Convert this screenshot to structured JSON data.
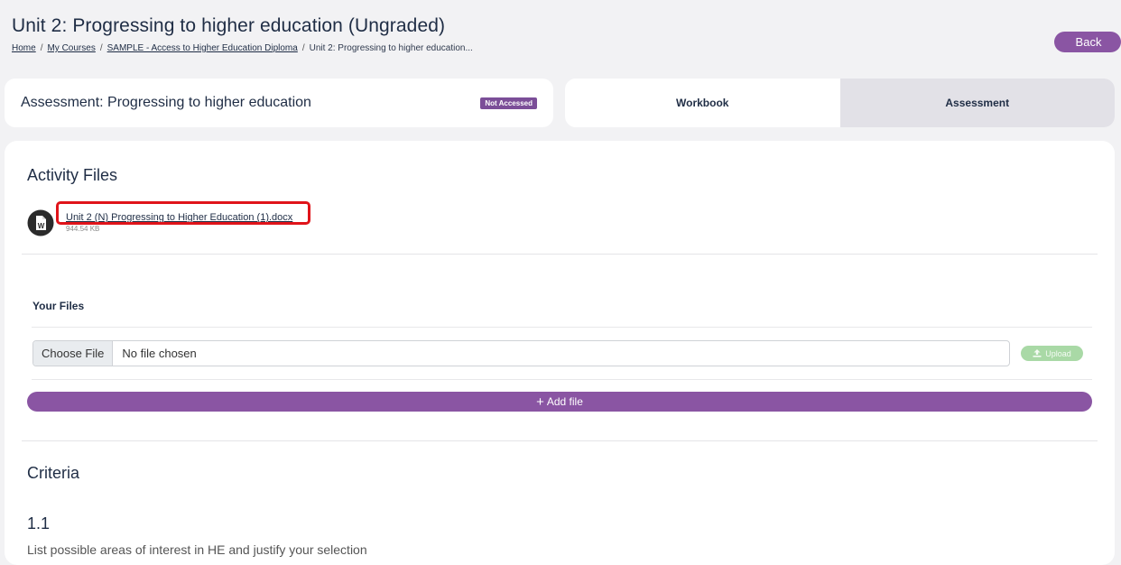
{
  "header": {
    "title": "Unit 2: Progressing to higher education (Ungraded)",
    "back_label": "Back"
  },
  "breadcrumb": {
    "items": [
      {
        "label": "Home"
      },
      {
        "label": "My Courses"
      },
      {
        "label": "SAMPLE - Access to Higher Education Diploma"
      }
    ],
    "current": "Unit 2: Progressing to higher education...",
    "separator": "/"
  },
  "assessment": {
    "title": "Assessment: Progressing to higher education",
    "status": "Not Accessed"
  },
  "tabs": [
    {
      "label": "Workbook",
      "active": false
    },
    {
      "label": "Assessment",
      "active": true
    }
  ],
  "activity_files": {
    "heading": "Activity Files",
    "files": [
      {
        "name": "Unit 2 (N) Progressing to Higher Education (1).docx",
        "size": "944.54 KB",
        "icon": "word-doc-icon"
      }
    ]
  },
  "your_files": {
    "heading": "Your Files",
    "choose_label": "Choose File",
    "no_file_text": "No file chosen",
    "upload_label": "Upload",
    "add_file_label": "Add file"
  },
  "criteria": {
    "heading": "Criteria",
    "number": "1.1",
    "text": "List possible areas of interest in HE and justify your selection"
  },
  "colors": {
    "brand_purple": "#8a55a3",
    "badge_purple": "#7b4e98",
    "upload_green": "#a9d9a6",
    "highlight_red": "#e0141a"
  }
}
